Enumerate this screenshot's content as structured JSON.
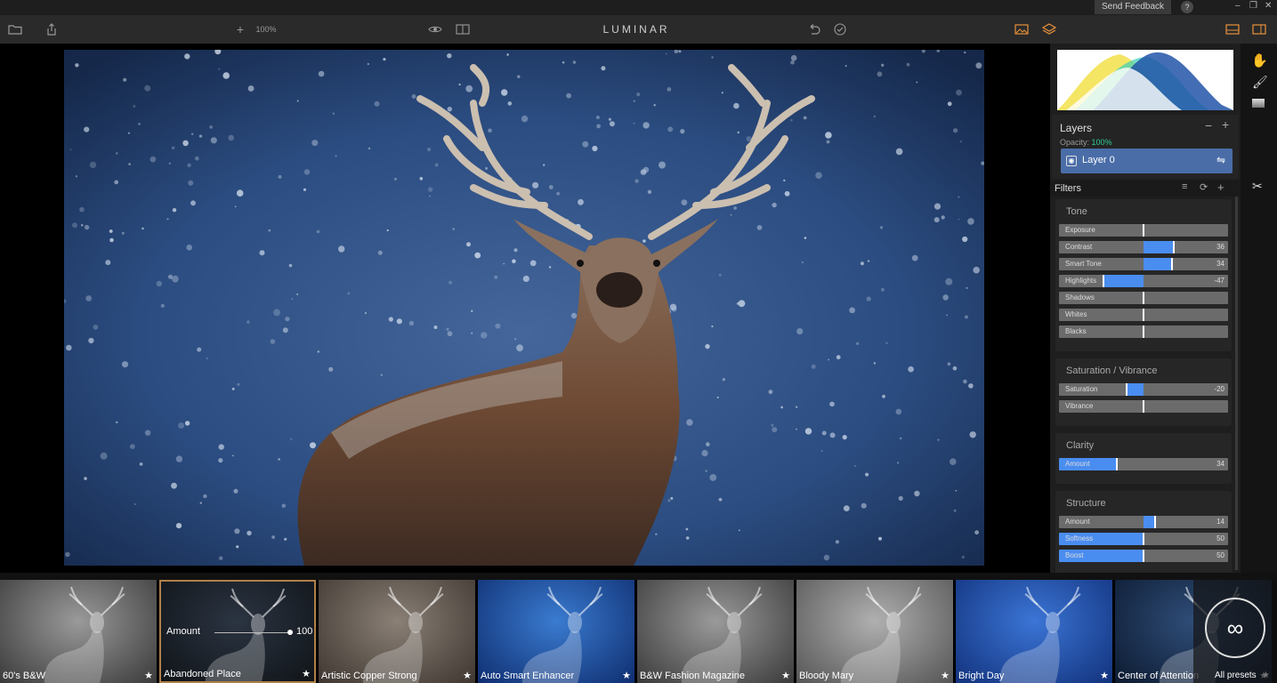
{
  "window": {
    "feedback_label": "Send Feedback",
    "help_label": "?",
    "minimize_glyph": "–",
    "restore_glyph": "❐",
    "close_glyph": "✕"
  },
  "toolbar": {
    "brand": "LUMINAR",
    "zoom_plus": "+",
    "zoom_level": "100%",
    "icons": {
      "open": "folder-icon",
      "share": "share-icon",
      "preview": "eye-icon",
      "compare": "split-view-icon",
      "undo": "undo-icon",
      "apply": "check-circle-icon",
      "image": "image-icon",
      "layers": "layers-icon",
      "layout": "layout-icon",
      "panel": "panel-icon"
    }
  },
  "layers": {
    "title": "Layers",
    "opacity_label": "Opacity:",
    "opacity_value": "100%",
    "minus": "−",
    "plus": "+",
    "layer_name": "Layer 0",
    "layer_eye": "◉",
    "layer_adjust": "⇋"
  },
  "filters": {
    "title": "Filters",
    "groups": [
      {
        "title": "Tone",
        "sliders": [
          {
            "label": "Exposure",
            "value": "",
            "num": 0
          },
          {
            "label": "Contrast",
            "value": "36",
            "num": 36
          },
          {
            "label": "Smart Tone",
            "value": "34",
            "num": 34
          },
          {
            "label": "Highlights",
            "value": "-47",
            "num": -47
          },
          {
            "label": "Shadows",
            "value": "",
            "num": 0
          },
          {
            "label": "Whites",
            "value": "",
            "num": 0
          },
          {
            "label": "Blacks",
            "value": "",
            "num": 0
          }
        ]
      },
      {
        "title": "Saturation / Vibrance",
        "sliders": [
          {
            "label": "Saturation",
            "value": "-20",
            "num": -20
          },
          {
            "label": "Vibrance",
            "value": "",
            "num": 0
          }
        ]
      },
      {
        "title": "Clarity",
        "sliders": [
          {
            "label": "Amount",
            "value": "34",
            "num": 34,
            "unipolar": true
          }
        ]
      },
      {
        "title": "Structure",
        "sliders": [
          {
            "label": "Amount",
            "value": "14",
            "num": 14
          },
          {
            "label": "Softness",
            "value": "50",
            "num": 50,
            "unipolar": true
          },
          {
            "label": "Boost",
            "value": "50",
            "num": 50,
            "unipolar": true
          }
        ]
      }
    ]
  },
  "presets": {
    "items": [
      {
        "name": "60's B&W",
        "tone": "bw",
        "selected": false
      },
      {
        "name": "Abandoned Place",
        "tone": "dark",
        "selected": true
      },
      {
        "name": "Artistic Copper Strong",
        "tone": "copper",
        "selected": false
      },
      {
        "name": "Auto Smart Enhancer",
        "tone": "blue",
        "selected": false
      },
      {
        "name": "B&W Fashion Magazine",
        "tone": "bw",
        "selected": false
      },
      {
        "name": "Bloody Mary",
        "tone": "grey",
        "selected": false
      },
      {
        "name": "Bright Day",
        "tone": "bright",
        "selected": false
      },
      {
        "name": "Center of Attention",
        "tone": "navy",
        "selected": false
      }
    ],
    "amount_label": "Amount",
    "amount_value": "100",
    "star": "★",
    "all_presets_label": "All presets",
    "all_presets_glyph": "∞"
  }
}
